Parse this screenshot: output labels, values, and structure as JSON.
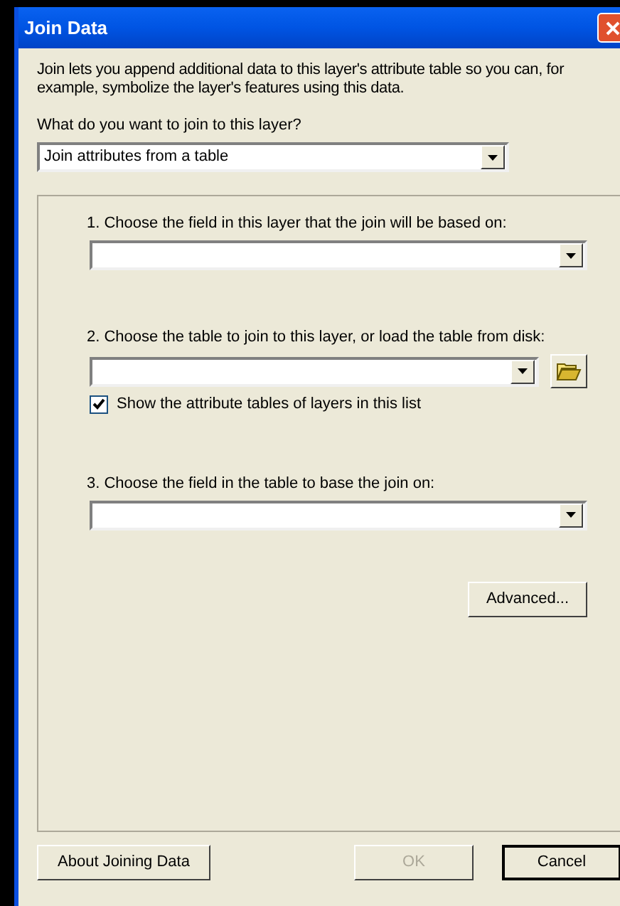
{
  "window": {
    "title": "Join Data"
  },
  "description": "Join lets you append additional data to this layer's attribute table so you can, for example, symbolize the layer's features using this data.",
  "join_type": {
    "label": "What do you want to join to this layer?",
    "value": "Join attributes from a table"
  },
  "steps": [
    {
      "label": "1.  Choose the field in this layer that the join will be based on:",
      "browse": false
    },
    {
      "label": "2.  Choose the table to join to this layer, or load the table from disk:",
      "browse": true,
      "checkbox": {
        "label": "Show the attribute tables of layers in this list",
        "checked": true
      }
    },
    {
      "label": "3.  Choose the field in the table to base the join on:",
      "browse": false
    }
  ],
  "advanced_button": {
    "label": "Advanced..."
  },
  "buttons": [
    {
      "label": "About Joining Data",
      "disabled": false,
      "default": false
    },
    {
      "label": "OK",
      "disabled": true,
      "default": false
    },
    {
      "label": "Cancel",
      "disabled": false,
      "default": true
    }
  ]
}
